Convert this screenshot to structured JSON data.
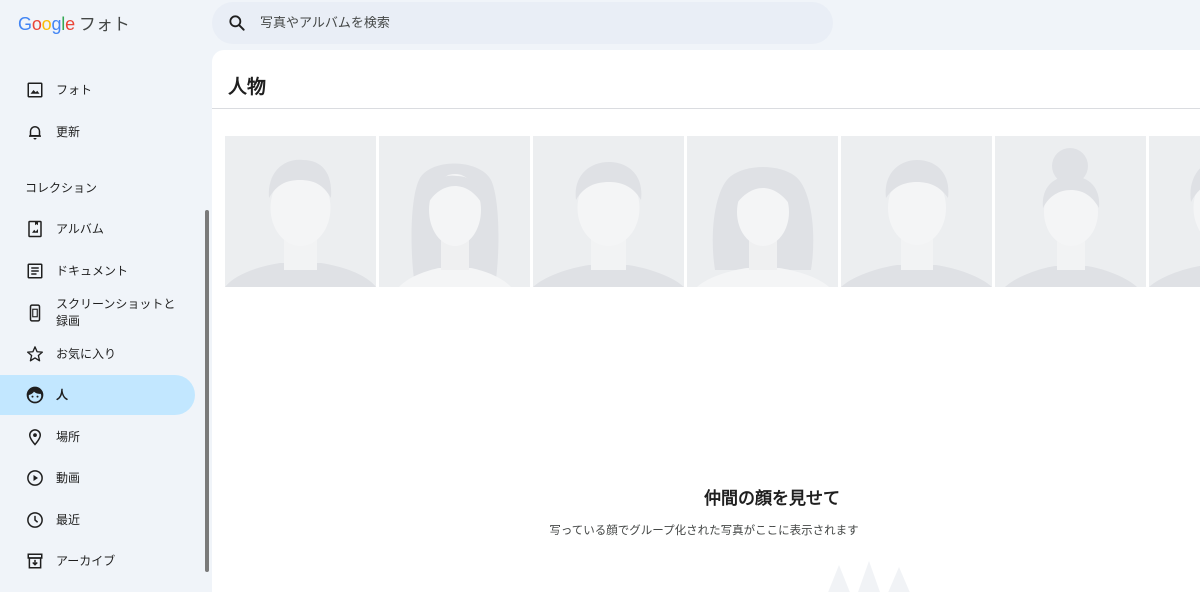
{
  "app": {
    "logo_text": "Google",
    "product_name": "フォト"
  },
  "search": {
    "placeholder": "写真やアルバムを検索",
    "icon": "search-icon"
  },
  "sidebar": {
    "items": [
      {
        "label": "フォト",
        "icon": "photo-icon"
      },
      {
        "label": "更新",
        "icon": "bell-icon"
      }
    ],
    "collection_heading": "コレクション",
    "collection_items": [
      {
        "label": "アルバム",
        "icon": "album-icon"
      },
      {
        "label": "ドキュメント",
        "icon": "document-icon"
      },
      {
        "label": "スクリーンショットと録画",
        "icon": "phone-screenshot-icon"
      },
      {
        "label": "お気に入り",
        "icon": "star-icon"
      },
      {
        "label": "人",
        "icon": "face-icon",
        "active": true
      },
      {
        "label": "場所",
        "icon": "location-pin-icon"
      },
      {
        "label": "動画",
        "icon": "play-circle-icon"
      },
      {
        "label": "最近",
        "icon": "clock-icon"
      },
      {
        "label": "アーカイブ",
        "icon": "archive-icon"
      }
    ]
  },
  "main": {
    "title": "人物",
    "placeholder_tiles": 7,
    "empty_state": {
      "title": "仲間の顔を見せて",
      "description": "写っている顔でグループ化された写真がここに表示されます"
    }
  },
  "colors": {
    "background": "#f0f4f9",
    "search_bg": "#e9eef6",
    "active_nav": "#c2e7ff",
    "tile_bg": "#eceef0",
    "silhouette": "#dfe1e5"
  }
}
